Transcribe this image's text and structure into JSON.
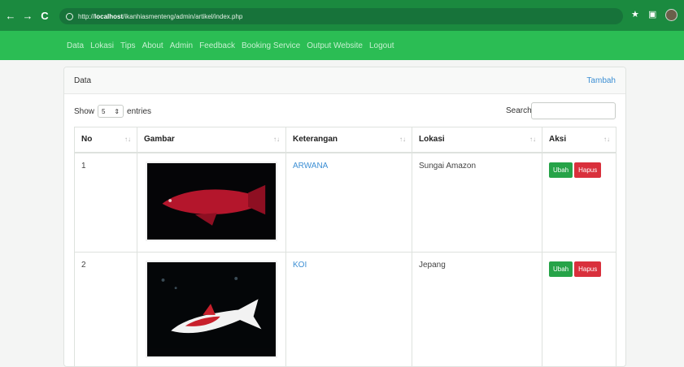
{
  "browser": {
    "back": "←",
    "forward": "→",
    "reload": "C",
    "url_prefix": "http://",
    "url_host": "localhost",
    "url_path": "/ikanhiasmenteng/admin/artikel/index.php"
  },
  "nav": [
    "Data",
    "Lokasi",
    "Tips",
    "About",
    "Admin",
    "Feedback",
    "Booking Service",
    "Output Website",
    "Logout"
  ],
  "card": {
    "title": "Data",
    "add_label": "Tambah"
  },
  "controls": {
    "show_label": "Show",
    "entries_value": "5",
    "entries_label": "entries",
    "search_label": "Search:"
  },
  "table": {
    "headers": [
      "No",
      "Gambar",
      "Keterangan",
      "Lokasi",
      "Aksi"
    ],
    "rows": [
      {
        "no": "1",
        "keterangan": "ARWANA",
        "lokasi": "Sungai Amazon",
        "edit": "Ubah",
        "delete": "Hapus"
      },
      {
        "no": "2",
        "keterangan": "KOI",
        "lokasi": "Jepang",
        "edit": "Ubah",
        "delete": "Hapus"
      }
    ]
  },
  "colors": {
    "browser_bar": "#1b8a3f",
    "app_nav": "#2bbd54",
    "link": "#3d8fd4",
    "ubah": "#26a348",
    "hapus": "#d9303c"
  },
  "icons": [
    "back-icon",
    "forward-icon",
    "reload-icon",
    "globe-icon",
    "star-icon",
    "window-icon",
    "avatar"
  ]
}
